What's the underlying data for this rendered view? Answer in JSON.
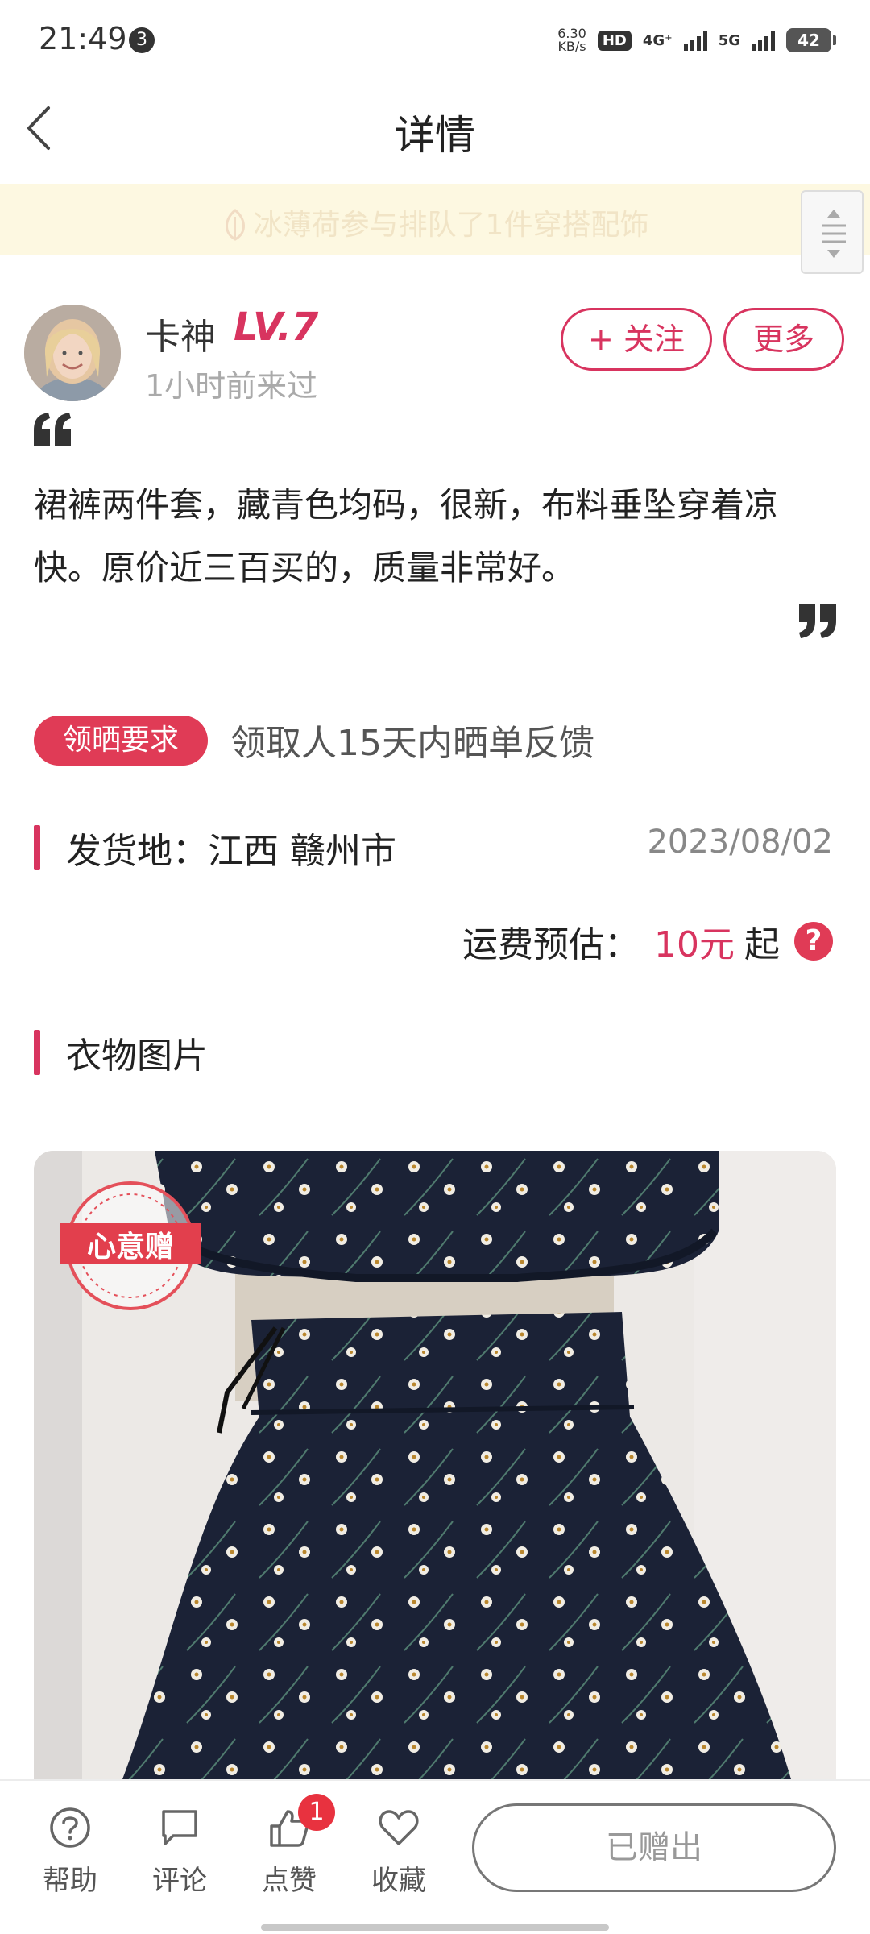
{
  "status_bar": {
    "time": "21:49",
    "notification_count": "3",
    "net_speed_value": "6.30",
    "net_speed_unit": "KB/s",
    "hd_label": "HD",
    "network_1": "4G⁺",
    "network_2": "5G",
    "battery": "42"
  },
  "nav": {
    "title": "详情"
  },
  "notice": {
    "text": "冰薄荷参与排队了1件穿搭配饰"
  },
  "user": {
    "name": "卡神",
    "level": "LV.7",
    "last_seen": "1小时前来过",
    "follow_label": "+ 关注",
    "more_label": "更多"
  },
  "post": {
    "description": "裙裤两件套，藏青色均码，很新，布料垂坠穿着凉快。原价近三百买的，质量非常好。"
  },
  "requirement": {
    "badge": "领晒要求",
    "text": "领取人15天内晒单反馈"
  },
  "location": {
    "text": "发货地：江西 赣州市",
    "date": "2023/08/02"
  },
  "shipping": {
    "label": "运费预估：",
    "price": "10元",
    "suffix": "起",
    "help_glyph": "?"
  },
  "photos": {
    "title": "衣物图片",
    "stamp_text": "心意赠"
  },
  "bottom_bar": {
    "tabs": [
      {
        "label": "帮助",
        "icon": "help-icon"
      },
      {
        "label": "评论",
        "icon": "comment-icon"
      },
      {
        "label": "点赞",
        "icon": "thumbs-up-icon",
        "badge": "1"
      },
      {
        "label": "收藏",
        "icon": "heart-icon"
      }
    ],
    "given_label": "已赠出"
  },
  "colors": {
    "accent": "#d8345f",
    "badge_red": "#e03b56",
    "notice_bg": "#fdf8e1"
  }
}
